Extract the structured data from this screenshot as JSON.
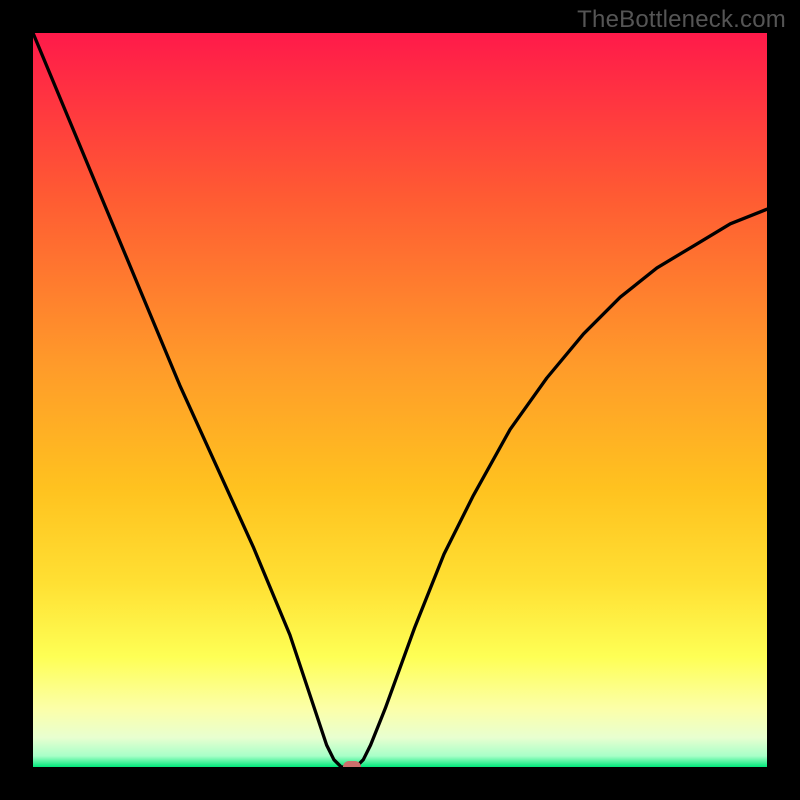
{
  "watermark": "TheBottleneck.com",
  "chart_data": {
    "type": "line",
    "title": "",
    "xlabel": "",
    "ylabel": "",
    "xlim": [
      0,
      100
    ],
    "ylim": [
      0,
      100
    ],
    "grid": false,
    "legend": false,
    "background_gradient": [
      "#ff1a4a",
      "#ff9a2a",
      "#ffd633",
      "#ffff66",
      "#f6ffcc",
      "#00e87a"
    ],
    "series": [
      {
        "name": "bottleneck-curve",
        "color": "#000000",
        "x": [
          0,
          5,
          10,
          15,
          20,
          25,
          30,
          35,
          38,
          40,
          41,
          42,
          43,
          44,
          45,
          46,
          48,
          52,
          56,
          60,
          65,
          70,
          75,
          80,
          85,
          90,
          95,
          100
        ],
        "values": [
          100,
          88,
          76,
          64,
          52,
          41,
          30,
          18,
          9,
          3,
          1,
          0,
          0,
          0,
          1,
          3,
          8,
          19,
          29,
          37,
          46,
          53,
          59,
          64,
          68,
          71,
          74,
          76
        ]
      }
    ],
    "marker": {
      "x": 43.5,
      "y": 0,
      "color": "#cc6f6c"
    }
  }
}
